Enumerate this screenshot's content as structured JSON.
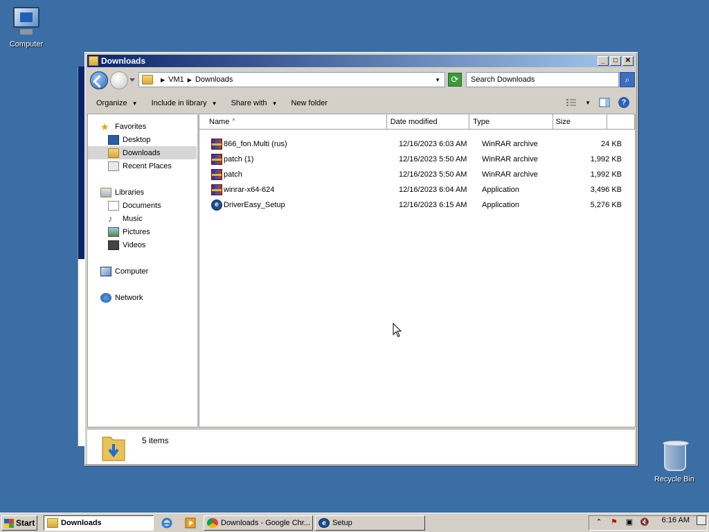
{
  "desktop": {
    "icons": [
      {
        "label": "Computer",
        "icon": "computer-icon"
      },
      {
        "label": "Recycle Bin",
        "icon": "recycle-bin-icon"
      }
    ]
  },
  "window": {
    "title": "Downloads",
    "address": {
      "crumbs": [
        "VM1",
        "Downloads"
      ]
    },
    "search_placeholder": "Search Downloads",
    "commands": {
      "organize": "Organize",
      "include": "Include in library",
      "share": "Share with",
      "new_folder": "New folder"
    },
    "nav": {
      "favorites": "Favorites",
      "desktop": "Desktop",
      "downloads": "Downloads",
      "recent": "Recent Places",
      "libraries": "Libraries",
      "documents": "Documents",
      "music": "Music",
      "pictures": "Pictures",
      "videos": "Videos",
      "computer": "Computer",
      "network": "Network"
    },
    "columns": {
      "name": "Name",
      "date": "Date modified",
      "type": "Type",
      "size": "Size"
    },
    "files": [
      {
        "name": "866_fon.Multi (rus)",
        "date": "12/16/2023 6:03 AM",
        "type": "WinRAR archive",
        "size": "24 KB",
        "icon": "winrar-icon"
      },
      {
        "name": "patch (1)",
        "date": "12/16/2023 5:50 AM",
        "type": "WinRAR archive",
        "size": "1,992 KB",
        "icon": "winrar-icon"
      },
      {
        "name": "patch",
        "date": "12/16/2023 5:50 AM",
        "type": "WinRAR archive",
        "size": "1,992 KB",
        "icon": "winrar-icon"
      },
      {
        "name": "winrar-x64-624",
        "date": "12/16/2023 6:04 AM",
        "type": "Application",
        "size": "3,496 KB",
        "icon": "winrar-icon"
      },
      {
        "name": "DriverEasy_Setup",
        "date": "12/16/2023 6:15 AM",
        "type": "Application",
        "size": "5,276 KB",
        "icon": "drivereasy-icon"
      }
    ],
    "item_count": "5 items"
  },
  "taskbar": {
    "start": "Start",
    "tasks": [
      {
        "label": "Downloads",
        "active": true
      },
      {
        "label": "Downloads - Google Chr...",
        "active": false
      },
      {
        "label": "Setup",
        "active": false
      }
    ],
    "clock": "6:16 AM"
  },
  "colors": {
    "desktop": "#3a6ea5",
    "titlebar": "#0a246a",
    "face": "#d4d0c8"
  }
}
